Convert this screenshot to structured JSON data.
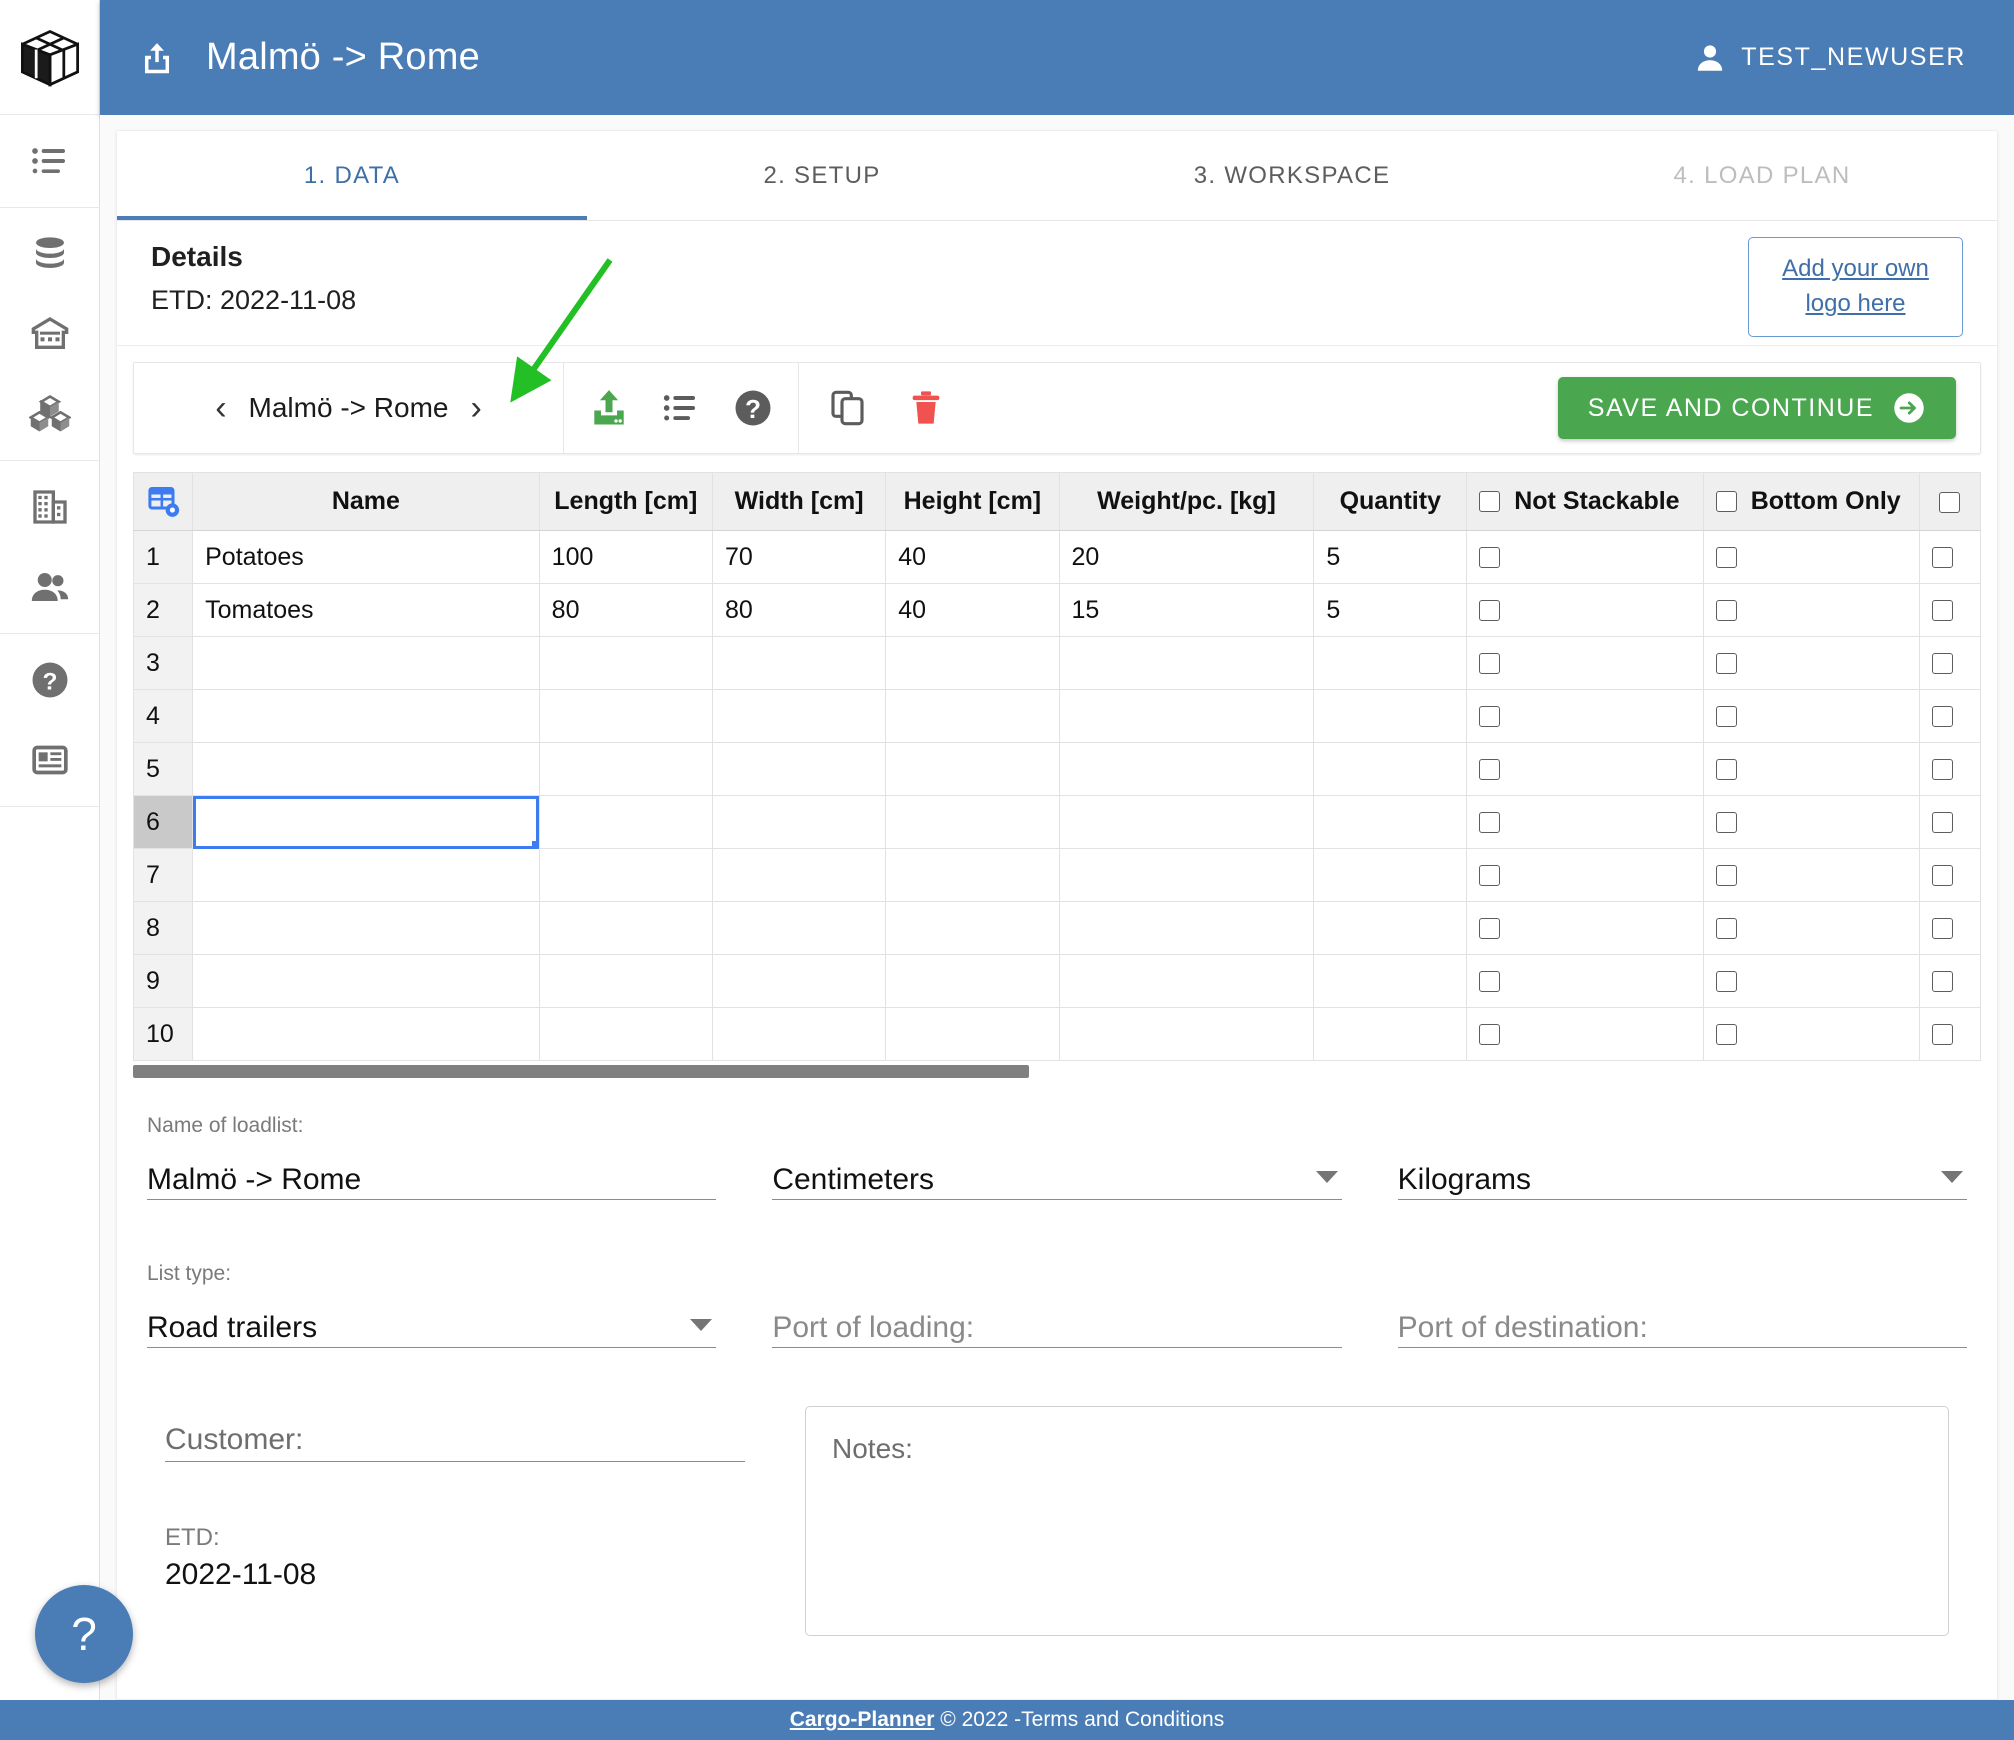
{
  "header": {
    "title": "Malmö -> Rome",
    "share_icon": "share-upload-icon",
    "user_icon": "person-icon",
    "user_name": "TEST_NEWUSER",
    "bg_color": "#4a7cb5"
  },
  "sidebar": {
    "logo_icon": "cargo-box-logo",
    "items": [
      {
        "icon": "list-icon",
        "name": "sidebar-item-loadlists"
      },
      {
        "icon": "database-icon",
        "name": "sidebar-item-database"
      },
      {
        "icon": "warehouse-icon",
        "name": "sidebar-item-warehouse"
      },
      {
        "icon": "boxes-icon",
        "name": "sidebar-item-packaging"
      },
      {
        "icon": "office-building-icon",
        "name": "sidebar-item-company"
      },
      {
        "icon": "people-icon",
        "name": "sidebar-item-users"
      },
      {
        "icon": "question-circle-icon",
        "name": "sidebar-item-help"
      },
      {
        "icon": "article-icon",
        "name": "sidebar-item-news"
      }
    ]
  },
  "tabs": [
    {
      "label": "1. DATA",
      "state": "active"
    },
    {
      "label": "2. SETUP",
      "state": "normal"
    },
    {
      "label": "3. WORKSPACE",
      "state": "normal"
    },
    {
      "label": "4. LOAD PLAN",
      "state": "disabled"
    }
  ],
  "details": {
    "title": "Details",
    "etd": "ETD: 2022-11-08",
    "logo_box_line1": "Add your own",
    "logo_box_line2": "logo here"
  },
  "toolbar": {
    "prev_label": "‹",
    "next_label": "›",
    "current_loadlist": "Malmö -> Rome",
    "icons": [
      {
        "name": "import-upload-icon",
        "color": "#4aa74f"
      },
      {
        "name": "list-icon",
        "color": "#606060"
      },
      {
        "name": "help-circle-icon",
        "color": "#606060"
      },
      {
        "name": "copy-duplicate-icon",
        "color": "#606060"
      },
      {
        "name": "delete-trash-icon",
        "color": "#f0534f"
      }
    ],
    "save_label": "SAVE AND CONTINUE",
    "save_icon": "arrow-right-circle-icon",
    "save_color": "#4aa74f"
  },
  "sheet": {
    "corner_icon": "table-settings-icon",
    "columns": [
      "Name",
      "Length [cm]",
      "Width [cm]",
      "Height [cm]",
      "Weight/pc. [kg]",
      "Quantity",
      "Not Stackable",
      "Bottom Only",
      ""
    ],
    "rows": [
      {
        "num": "1",
        "name": "Potatoes",
        "length": "100",
        "width": "70",
        "height": "40",
        "weight": "20",
        "quantity": "5",
        "not_stackable": false,
        "bottom_only": false,
        "extra": false
      },
      {
        "num": "2",
        "name": "Tomatoes",
        "length": "80",
        "width": "80",
        "height": "40",
        "weight": "15",
        "quantity": "5",
        "not_stackable": false,
        "bottom_only": false,
        "extra": false
      },
      {
        "num": "3",
        "name": "",
        "length": "",
        "width": "",
        "height": "",
        "weight": "",
        "quantity": "",
        "not_stackable": false,
        "bottom_only": false,
        "extra": false
      },
      {
        "num": "4",
        "name": "",
        "length": "",
        "width": "",
        "height": "",
        "weight": "",
        "quantity": "",
        "not_stackable": false,
        "bottom_only": false,
        "extra": false
      },
      {
        "num": "5",
        "name": "",
        "length": "",
        "width": "",
        "height": "",
        "weight": "",
        "quantity": "",
        "not_stackable": false,
        "bottom_only": false,
        "extra": false
      },
      {
        "num": "6",
        "name": "",
        "length": "",
        "width": "",
        "height": "",
        "weight": "",
        "quantity": "",
        "not_stackable": false,
        "bottom_only": false,
        "extra": false
      },
      {
        "num": "7",
        "name": "",
        "length": "",
        "width": "",
        "height": "",
        "weight": "",
        "quantity": "",
        "not_stackable": false,
        "bottom_only": false,
        "extra": false
      },
      {
        "num": "8",
        "name": "",
        "length": "",
        "width": "",
        "height": "",
        "weight": "",
        "quantity": "",
        "not_stackable": false,
        "bottom_only": false,
        "extra": false
      },
      {
        "num": "9",
        "name": "",
        "length": "",
        "width": "",
        "height": "",
        "weight": "",
        "quantity": "",
        "not_stackable": false,
        "bottom_only": false,
        "extra": false
      },
      {
        "num": "10",
        "name": "",
        "length": "",
        "width": "",
        "height": "",
        "weight": "",
        "quantity": "",
        "not_stackable": false,
        "bottom_only": false,
        "extra": false
      }
    ],
    "selected_cell": {
      "row": 6,
      "column": "Name"
    }
  },
  "form": {
    "name_of_loadlist_label": "Name of loadlist:",
    "name_of_loadlist_value": "Malmö -> Rome",
    "dimension_unit_value": "Centimeters",
    "weight_unit_value": "Kilograms",
    "list_type_label": "List type:",
    "list_type_value": "Road trailers",
    "port_of_loading_placeholder": "Port of loading:",
    "port_of_destination_placeholder": "Port of destination:",
    "customer_placeholder": "Customer:",
    "etd_label": "ETD:",
    "etd_value": "2022-11-08",
    "notes_placeholder": "Notes:"
  },
  "footer": {
    "brand": "Cargo-Planner",
    "rest": " © 2022 -Terms and Conditions"
  },
  "help_fab": {
    "label": "?"
  },
  "annotation": {
    "type": "green-arrow",
    "color": "#22c024"
  }
}
